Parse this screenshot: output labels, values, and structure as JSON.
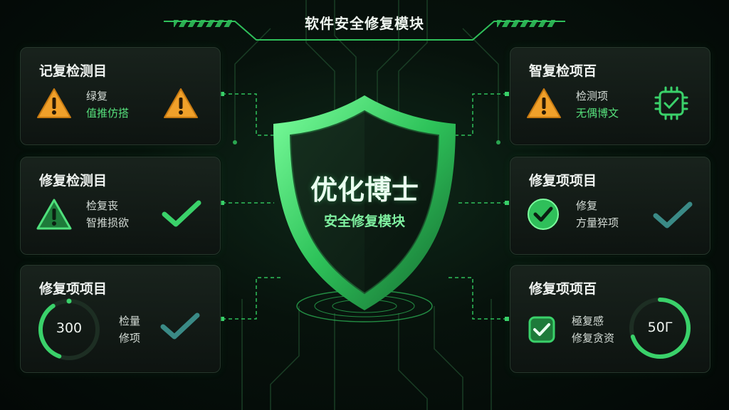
{
  "header": {
    "title": "软件安全修复模块"
  },
  "shield": {
    "title": "优化博士",
    "subtitle": "安全修复模块"
  },
  "cards": {
    "left_top": {
      "title": "记复检测目",
      "line1": "绿复",
      "line2": "值推仿搭"
    },
    "left_mid": {
      "title": "修复检测目",
      "line1": "检复丧",
      "line2": "智推损欲"
    },
    "left_bot": {
      "title": "修复项项目",
      "gauge_value": "300",
      "gauge_fraction": 0.35,
      "line1": "检量",
      "line2": "修项"
    },
    "right_top": {
      "title": "智复检项百",
      "line1": "检测项",
      "line2": "无偶博文"
    },
    "right_mid": {
      "title": "修复项项目",
      "line1": "修复",
      "line2": "方量猝项"
    },
    "right_bot": {
      "title": "修复项项百",
      "gauge_value": "50Γ",
      "gauge_fraction": 0.7,
      "line1": "極复感",
      "line2": "修复贪资"
    }
  },
  "colors": {
    "accent": "#3ad16a",
    "warning": "#f0a02a",
    "teal_check": "#3a8a86",
    "bg": "#07120c"
  }
}
